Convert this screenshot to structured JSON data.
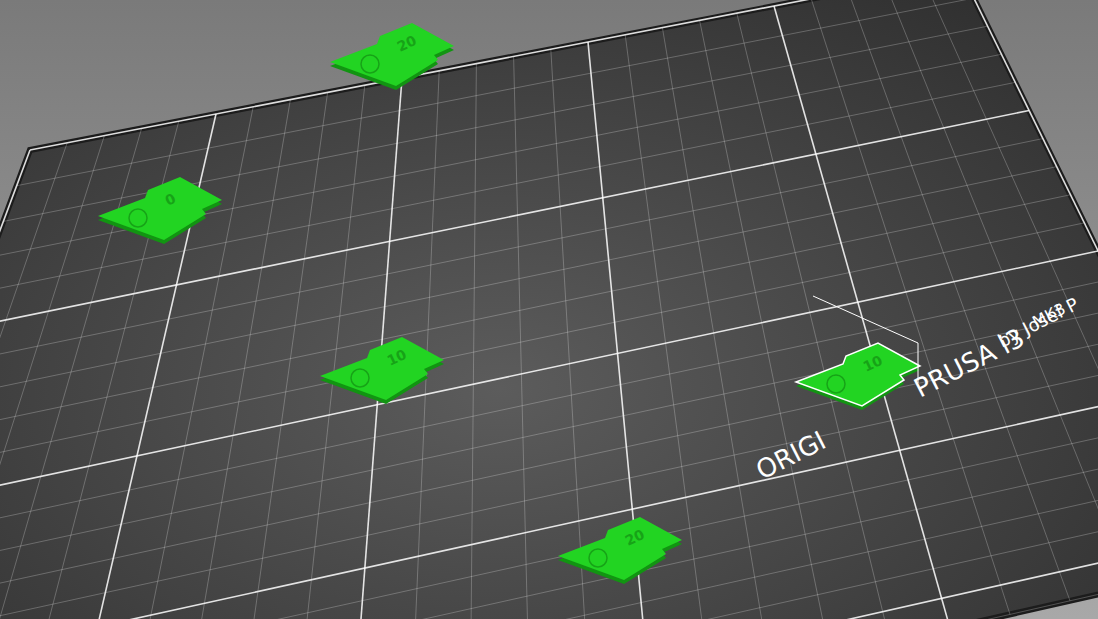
{
  "bed": {
    "logo": [
      {
        "text": "ORIGI"
      },
      {
        "text": "PRUSA i3"
      },
      {
        "text": "MK3"
      },
      {
        "text": "by Josef P"
      }
    ]
  },
  "objects": [
    {
      "label": "20",
      "selected": false
    },
    {
      "label": "0",
      "selected": false
    },
    {
      "label": "10",
      "selected": false
    },
    {
      "label": "10",
      "selected": true
    },
    {
      "label": "20",
      "selected": false
    }
  ]
}
